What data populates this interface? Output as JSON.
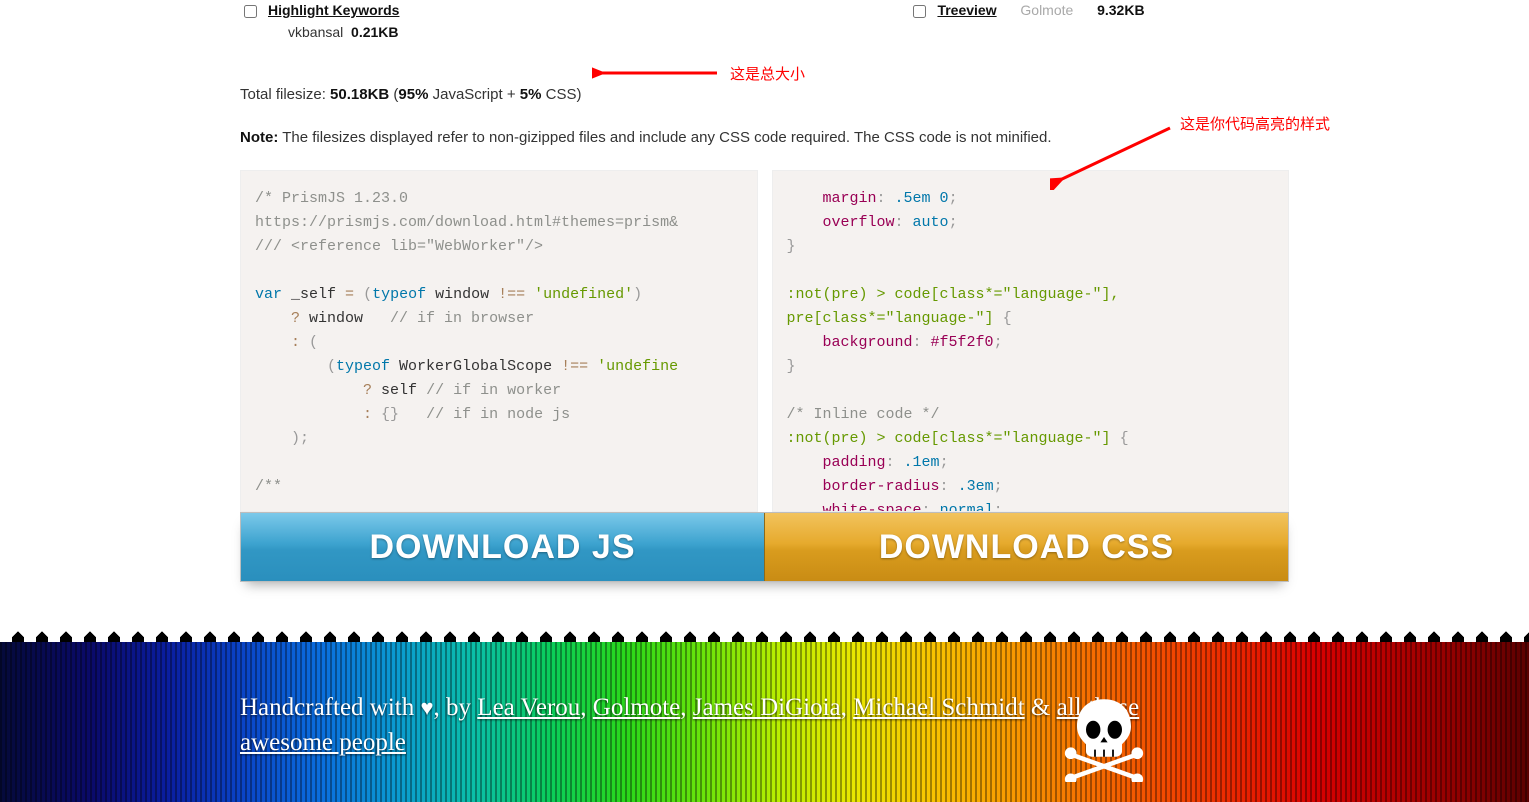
{
  "plugins": {
    "left": {
      "name": "Highlight Keywords",
      "author": "vkbansal",
      "size": "0.21KB"
    },
    "right": {
      "name": "Treeview",
      "author": "Golmote",
      "size": "9.32KB"
    }
  },
  "total": {
    "prefix": "Total filesize: ",
    "size": "50.18KB",
    "detail_open": " (",
    "js_pct": "95%",
    "js_label": " JavaScript + ",
    "css_pct": "5%",
    "css_label": " CSS)",
    "raw": "Total filesize: 50.18KB (95% JavaScript + 5% CSS)"
  },
  "note": {
    "label": "Note:",
    "text": " The filesizes displayed refer to non-gizipped files and include any CSS code required. The CSS code is not minified."
  },
  "annotations": {
    "total": "这是总大小",
    "style": "这是你代码高亮的样式"
  },
  "code_left": {
    "l1": "/* PrismJS 1.23.0",
    "l2": "https://prismjs.com/download.html#themes=prism&",
    "l3": "/// <reference lib=\"WebWorker\"/>",
    "kw_var": "var",
    "self": " _self ",
    "eq": "=",
    "sp": " ",
    "lp": "(",
    "typeof": "typeof",
    "window": " window ",
    "neq": "!==",
    "str_undef": " 'undefined'",
    "rp": ")",
    "q": "?",
    "win2": " window   ",
    "cmt_browser": "// if in browser",
    "colon": ":",
    "lp2": " (",
    "worker": " WorkerGlobalScope ",
    "str_undef2": " 'undefine",
    "self2": " self ",
    "cmt_worker": "// if in worker",
    "obj": " {}   ",
    "cmt_node": "// if in node js",
    "rp2": ");",
    "blk": "/**"
  },
  "code_right": {
    "margin": "margin",
    "margin_v": ".5em 0",
    "overflow": "overflow",
    "overflow_v": "auto",
    "sel1": ":not(pre) > code[class*=\"language-\"],",
    "sel2": "pre[class*=\"language-\"]",
    "bg": "background",
    "bg_v": "#f5f2f0",
    "cmt_inline": "/* Inline code */",
    "sel3": ":not(pre) > code[class*=\"language-\"]",
    "padding": "padding",
    "padding_v": ".1em",
    "radius": "border-radius",
    "radius_v": ".3em",
    "ws": "white-space",
    "ws_v": "normal",
    "semi": ";",
    "lb": "{",
    "rb": "}",
    "colon": ": "
  },
  "buttons": {
    "js": "DOWNLOAD JS",
    "css": "DOWNLOAD CSS"
  },
  "footer": {
    "hand": "Handcrafted with ",
    "heart": "♥",
    "by": ", by ",
    "a1": "Lea Verou",
    "c1": ", ",
    "a2": "Golmote",
    "c2": ", ",
    "a3": "James DiGioia",
    "c3": ", ",
    "a4": "Michael Schmidt",
    "amp": " & ",
    "a5": "all these awesome people"
  }
}
